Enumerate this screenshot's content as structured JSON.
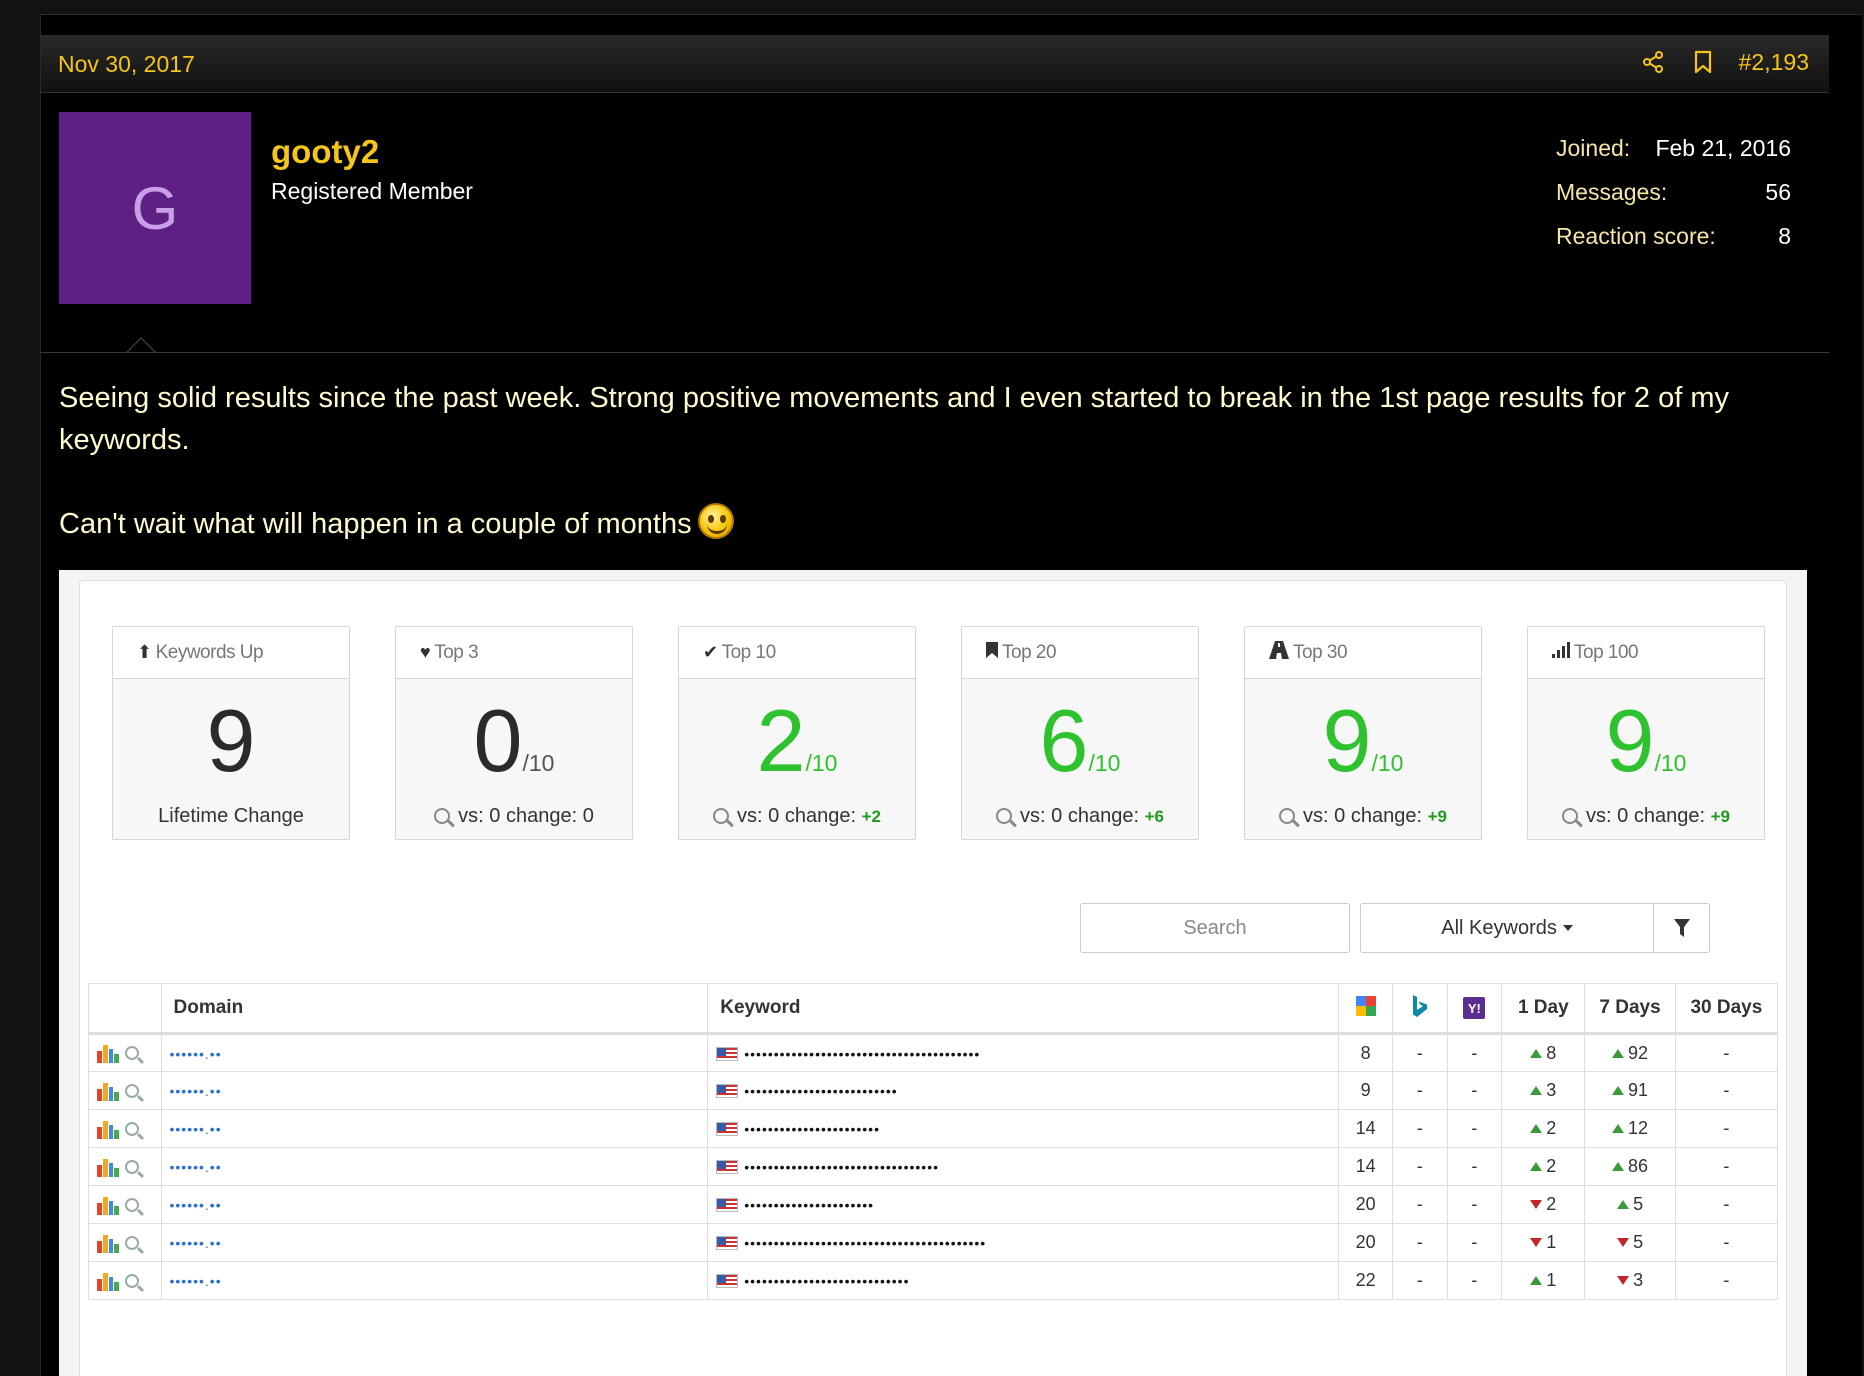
{
  "post": {
    "date": "Nov 30, 2017",
    "number": "#2,193",
    "icons": {
      "share": "share-icon",
      "bookmark": "bookmark-icon"
    }
  },
  "user": {
    "avatar_letter": "G",
    "avatar_color": "#5e2084",
    "name": "gooty2",
    "title": "Registered Member",
    "stats": [
      {
        "label": "Joined:",
        "value": "Feb 21, 2016"
      },
      {
        "label": "Messages:",
        "value": "56"
      },
      {
        "label": "Reaction score:",
        "value": "8"
      }
    ]
  },
  "message": {
    "para1": "Seeing solid results since the past week. Strong positive movements and I even started to break in the 1st page results for 2 of my keywords.",
    "para2": "Can't wait what will happen in a couple of months"
  },
  "dashboard": {
    "cards": [
      {
        "icon": "arrow-up-icon",
        "glyph": "⬆",
        "title": "Keywords Up",
        "value": "9",
        "denominator": "",
        "foot": "Lifetime Change",
        "change": ""
      },
      {
        "icon": "heart-icon",
        "glyph": "♥",
        "title": "Top 3",
        "value": "0",
        "denominator": "/10",
        "foot": "vs: 0 change: 0",
        "change": ""
      },
      {
        "icon": "check-icon",
        "glyph": "✔",
        "title": "Top 10",
        "value": "2",
        "denominator": "/10",
        "foot": "vs: 0 change: ",
        "change": "+2"
      },
      {
        "icon": "bookmark-icon",
        "glyph": "▮",
        "title": "Top 20",
        "value": "6",
        "denominator": "/10",
        "foot": "vs: 0 change: ",
        "change": "+6"
      },
      {
        "icon": "road-icon",
        "glyph": "▲",
        "title": "Top 30",
        "value": "9",
        "denominator": "/10",
        "foot": "vs: 0 change: ",
        "change": "+9"
      },
      {
        "icon": "signal-icon",
        "glyph": "▁▃▅",
        "title": "Top 100",
        "value": "9",
        "denominator": "/10",
        "foot": "vs: 0 change: ",
        "change": "+9"
      }
    ],
    "search_placeholder": "Search",
    "keyword_filter": "All Keywords",
    "table": {
      "headers": {
        "domain": "Domain",
        "keyword": "Keyword",
        "day1": "1 Day",
        "day7": "7 Days",
        "day30": "30 Days"
      },
      "engines": [
        "google-icon",
        "bing-icon",
        "yahoo-icon"
      ],
      "rows": [
        {
          "domain": "••••••.••",
          "keyword": "••••••••••••••••••••••••••••••••••••••••",
          "google": "8",
          "bing": "-",
          "yahoo": "-",
          "d1_dir": "up",
          "d1": "8",
          "d7_dir": "up",
          "d7": "92",
          "d30": "-"
        },
        {
          "domain": "••••••.••",
          "keyword": "••••••••••••••••••••••••••",
          "google": "9",
          "bing": "-",
          "yahoo": "-",
          "d1_dir": "up",
          "d1": "3",
          "d7_dir": "up",
          "d7": "91",
          "d30": "-"
        },
        {
          "domain": "••••••.••",
          "keyword": "•••••••••••••••••••••••",
          "google": "14",
          "bing": "-",
          "yahoo": "-",
          "d1_dir": "up",
          "d1": "2",
          "d7_dir": "up",
          "d7": "12",
          "d30": "-"
        },
        {
          "domain": "••••••.••",
          "keyword": "•••••••••••••••••••••••••••••••••",
          "google": "14",
          "bing": "-",
          "yahoo": "-",
          "d1_dir": "up",
          "d1": "2",
          "d7_dir": "up",
          "d7": "86",
          "d30": "-"
        },
        {
          "domain": "••••••.••",
          "keyword": "••••••••••••••••••••••",
          "google": "20",
          "bing": "-",
          "yahoo": "-",
          "d1_dir": "down",
          "d1": "2",
          "d7_dir": "up",
          "d7": "5",
          "d30": "-"
        },
        {
          "domain": "••••••.••",
          "keyword": "•••••••••••••••••••••••••••••••••••••••••",
          "google": "20",
          "bing": "-",
          "yahoo": "-",
          "d1_dir": "down",
          "d1": "1",
          "d7_dir": "down",
          "d7": "5",
          "d30": "-"
        },
        {
          "domain": "••••••.••",
          "keyword": "••••••••••••••••••••••••••••",
          "google": "22",
          "bing": "-",
          "yahoo": "-",
          "d1_dir": "up",
          "d1": "1",
          "d7_dir": "down",
          "d7": "3",
          "d30": "-"
        }
      ]
    }
  },
  "colors": {
    "accent": "#f5c518",
    "positive": "#2ec22e",
    "negative": "#c0262c"
  }
}
